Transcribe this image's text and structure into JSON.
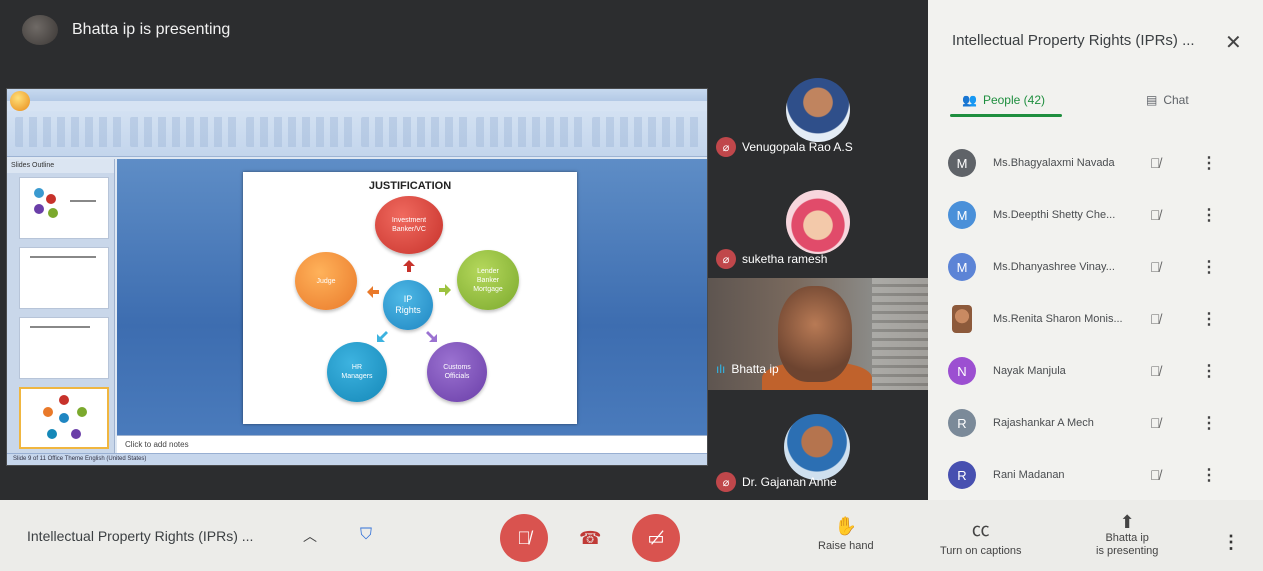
{
  "presenter": {
    "label": "Bhatta ip is presenting"
  },
  "slide": {
    "title": "JUSTIFICATION",
    "center": "IP\nRights",
    "nodes": [
      "Investment\nBanker/VC",
      "Lender\nBanker\nMortgage",
      "Customs\nOfficials",
      "HR\nManagers",
      "Judge"
    ],
    "notes_placeholder": "Click to add notes"
  },
  "ppt": {
    "thumb_tabs": "Slides  Outline",
    "status": "Slide 9 of 11    Office Theme    English (United States)"
  },
  "tiles": [
    {
      "name": "Venugopala Rao A.S"
    },
    {
      "name": "suketha ramesh"
    },
    {
      "name": "Bhatta ip"
    },
    {
      "name": "Dr. Gajanan Anne"
    }
  ],
  "panel": {
    "title": "Intellectual Property Rights (IPRs) ...",
    "tabs": {
      "people": "People (42)",
      "chat": "Chat"
    },
    "participants": [
      {
        "initial": "M",
        "name": "Ms.Bhagyalaxmi Navada",
        "color": "#5f6368"
      },
      {
        "initial": "M",
        "name": "Ms.Deepthi Shetty Che...",
        "color": "#4a90d9"
      },
      {
        "initial": "M",
        "name": "Ms.Dhanyashree Vinay...",
        "color": "#5c84d6"
      },
      {
        "initial": "",
        "name": "Ms.Renita Sharon Monis...",
        "color": "#8d5a3b"
      },
      {
        "initial": "N",
        "name": "Nayak Manjula",
        "color": "#9c4fd1"
      },
      {
        "initial": "R",
        "name": "Rajashankar A Mech",
        "color": "#7b8a99"
      },
      {
        "initial": "R",
        "name": "Rani Madanan",
        "color": "#4750b0"
      }
    ]
  },
  "bottombar": {
    "meeting_title": "Intellectual Property Rights (IPRs) ...",
    "raise_hand": "Raise hand",
    "captions": "Turn on captions",
    "presenting_line1": "Bhatta ip",
    "presenting_line2": "is presenting"
  },
  "colors": {
    "accent_green": "#1e8e3e",
    "danger_red": "#d9534f",
    "stage_bg": "#2c2d2f"
  }
}
